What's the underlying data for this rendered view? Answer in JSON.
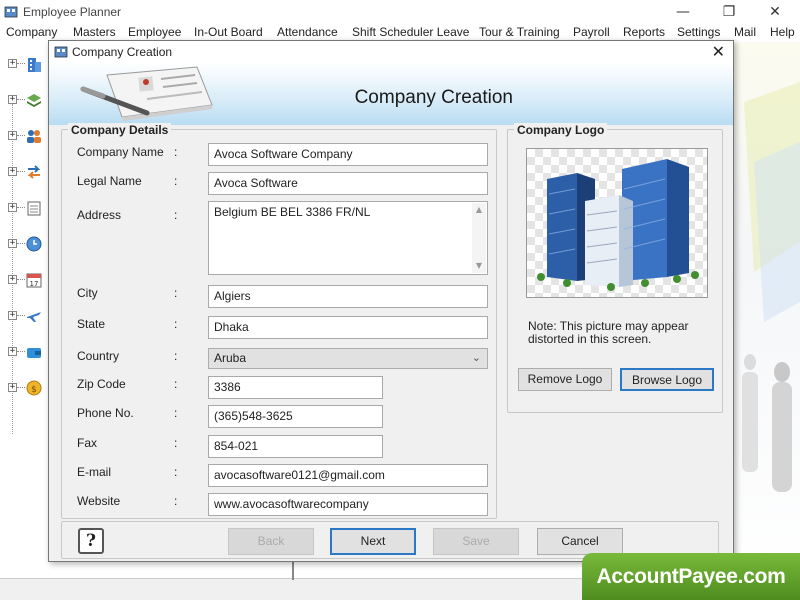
{
  "app": {
    "title": "Employee Planner",
    "window_controls": {
      "minimize": "—",
      "maximize": "❐",
      "close": "✕"
    }
  },
  "menu": [
    "Company",
    "Masters",
    "Employee",
    "In-Out Board",
    "Attendance",
    "Shift Scheduler Leave",
    "Tour & Training",
    "Payroll",
    "Reports",
    "Settings",
    "Mail",
    "Help"
  ],
  "tree_icons": [
    "building-icon",
    "layers-icon",
    "people-icon",
    "transfer-icon",
    "calendar-list-icon",
    "clock-icon",
    "calendar-17-icon",
    "airplane-icon",
    "wallet-icon",
    "coin-icon"
  ],
  "tree_calendar_day": "17",
  "dialog": {
    "title": "Company Creation",
    "close": "✕",
    "header_title": "Company Creation",
    "details_group_title": "Company Details",
    "logo_group_title": "Company Logo",
    "fields": {
      "company_name": {
        "label": "Company Name",
        "value": "Avoca Software Company"
      },
      "legal_name": {
        "label": "Legal Name",
        "value": "Avoca Software"
      },
      "address": {
        "label": "Address",
        "value": "Belgium BE BEL 3386 FR/NL"
      },
      "city": {
        "label": "City",
        "value": "Algiers"
      },
      "state": {
        "label": "State",
        "value": "Dhaka"
      },
      "country": {
        "label": "Country",
        "value": "Aruba"
      },
      "zip": {
        "label": "Zip Code",
        "value": "3386"
      },
      "phone": {
        "label": "Phone No.",
        "value": "(365)548-3625"
      },
      "fax": {
        "label": "Fax",
        "value": "854-021"
      },
      "email": {
        "label": "E-mail",
        "value": "avocasoftware0121@gmail.com"
      },
      "website": {
        "label": "Website",
        "value": "www.avocasoftwarecompany"
      }
    },
    "colon": ":",
    "logo_note": "Note: This picture may appear distorted in this screen.",
    "remove_logo": "Remove Logo",
    "browse_logo": "Browse Logo",
    "help": "?",
    "buttons": {
      "back": "Back",
      "next": "Next",
      "save": "Save",
      "cancel": "Cancel"
    }
  },
  "brand": "AccountPayee.com",
  "colors": {
    "accent": "#2b78c5",
    "header_blue": "#b8dcf2",
    "brand_green": "#5f9e2a"
  }
}
